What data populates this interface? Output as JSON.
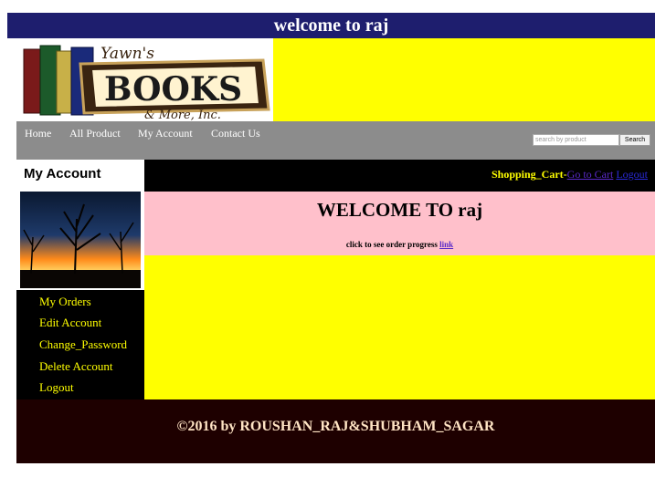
{
  "header": {
    "title": "welcome to raj"
  },
  "logo": {
    "line1": "Yawn's",
    "line2": "BOOKS",
    "line3": "& More, Inc."
  },
  "nav": {
    "items": [
      "Home",
      "All Product",
      "My Account",
      "Contact Us"
    ],
    "search_placeholder": "search by product",
    "search_button": "Search"
  },
  "sidebar": {
    "heading": "My Account",
    "menu": [
      "My Orders",
      "Edit Account",
      "Change_Password",
      "Delete Account",
      "Logout"
    ]
  },
  "cart": {
    "label": "Shopping_Cart-",
    "go_to_cart": "Go to Cart",
    "logout": "Logout"
  },
  "main": {
    "welcome": "WELCOME TO raj",
    "progress_text": "click to see order progress",
    "progress_link": "link"
  },
  "footer": {
    "text": "©2016 by ROUSHAN_RAJ&SHUBHAM_SAGAR"
  },
  "colors": {
    "topbar": "#1e1e6e",
    "accent_yellow": "#ffff00",
    "pink": "#ffc0cb",
    "footer": "#1e0000"
  }
}
